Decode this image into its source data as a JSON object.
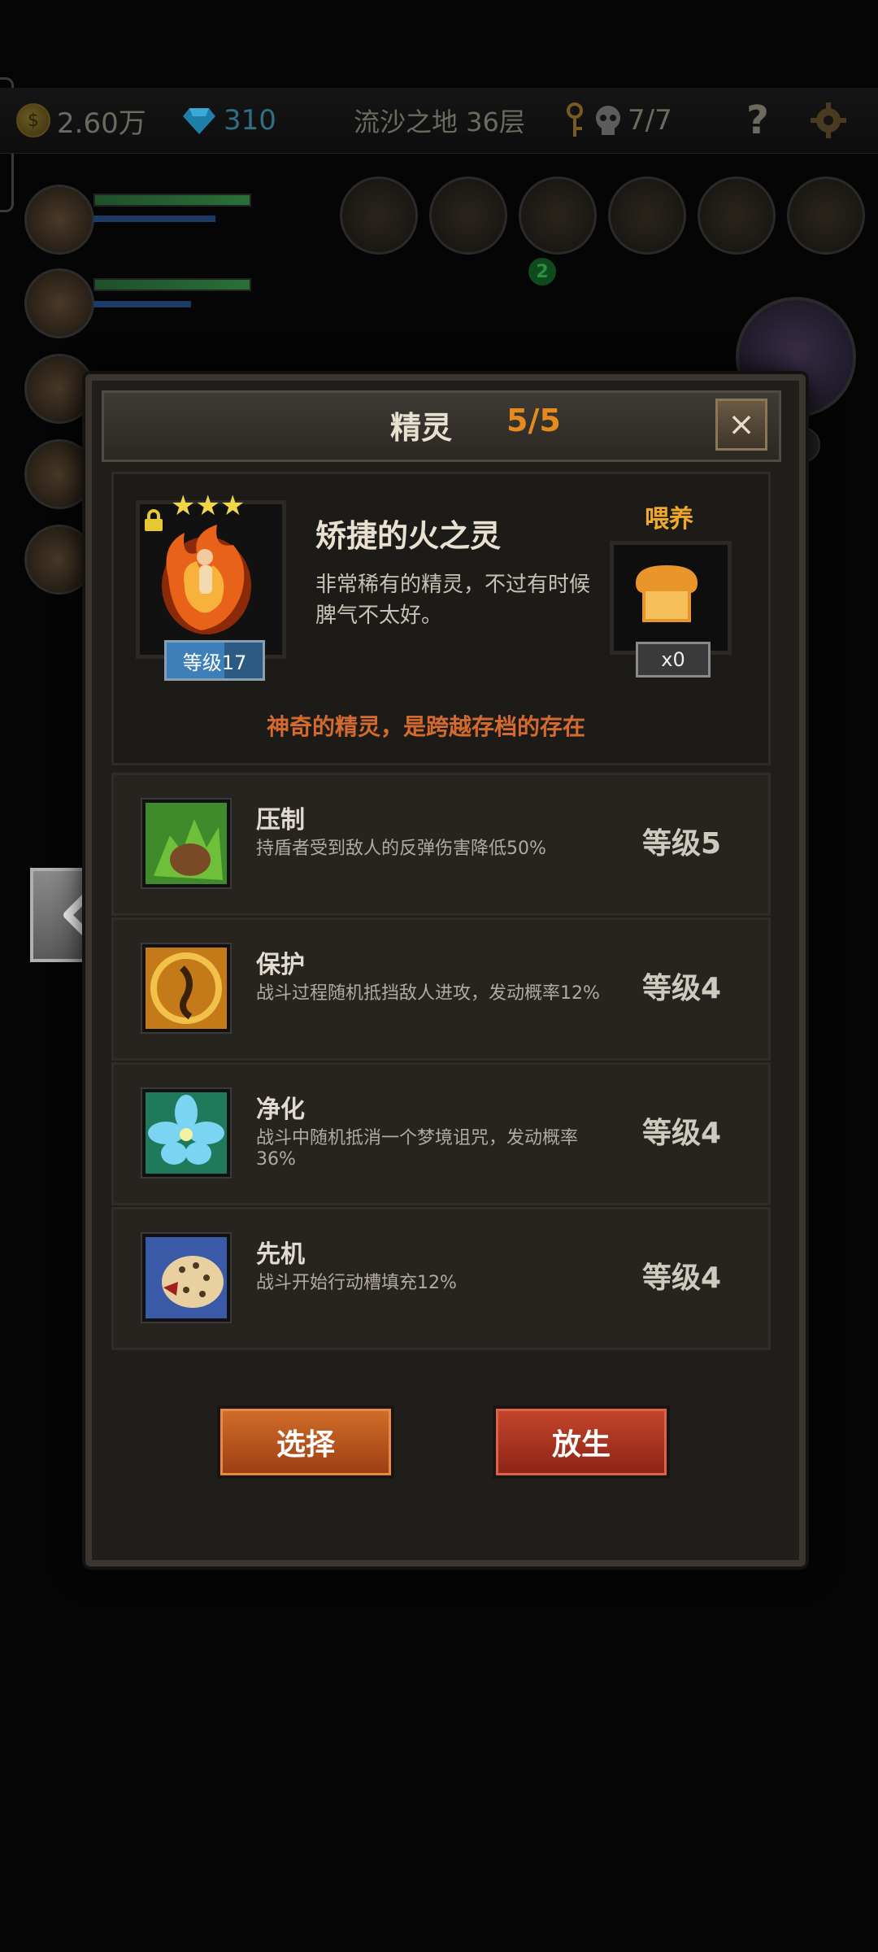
{
  "hud": {
    "coins": "2.60万",
    "gems": "310",
    "location": "流沙之地 36层",
    "skulls": "7/7",
    "help": "?"
  },
  "background": {
    "item_badge": "2",
    "portrait_badge": "2"
  },
  "panel": {
    "title": "精灵",
    "count": "5/5",
    "close": "×"
  },
  "spirit": {
    "stars": "★★★",
    "level": "等级17",
    "name": "矫捷的火之灵",
    "description": "非常稀有的精灵，不过有时候脾气不太好。",
    "tagline": "神奇的精灵，是跨越存档的存在"
  },
  "feed": {
    "label": "喂养",
    "count": "x0"
  },
  "skills": [
    {
      "name": "压制",
      "desc": "持盾者受到敌人的反弹伤害降低50%",
      "level": "等级5"
    },
    {
      "name": "保护",
      "desc": "战斗过程随机抵挡敌人进攻，发动概率12%",
      "level": "等级4"
    },
    {
      "name": "净化",
      "desc": "战斗中随机抵消一个梦境诅咒，发动概率36%",
      "level": "等级4"
    },
    {
      "name": "先机",
      "desc": "战斗开始行动槽填充12%",
      "level": "等级4"
    }
  ],
  "buttons": {
    "select": "选择",
    "release": "放生"
  },
  "colors": {
    "accent_orange": "#e58b1e",
    "tagline": "#d46a2e",
    "panel_bg": "#201e1b"
  }
}
